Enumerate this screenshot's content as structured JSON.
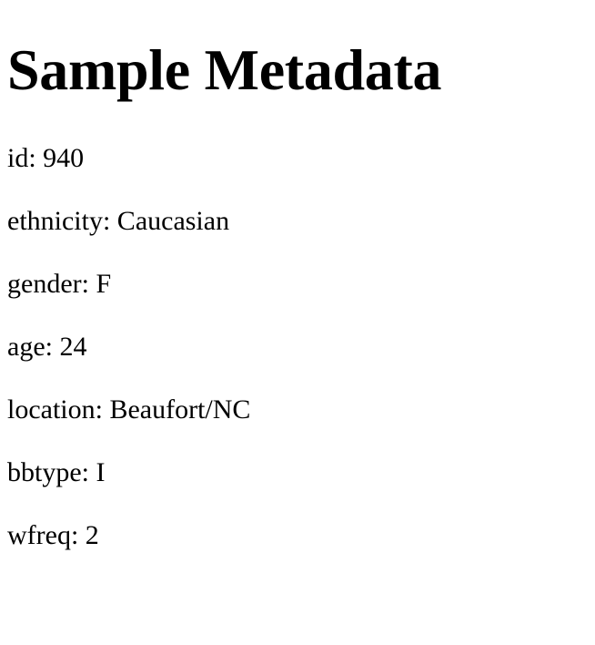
{
  "page": {
    "title": "Sample Metadata"
  },
  "metadata": [
    "id: 940",
    "ethnicity: Caucasian",
    "gender: F",
    "age: 24",
    "location: Beaufort/NC",
    "bbtype: I",
    "wfreq: 2"
  ]
}
